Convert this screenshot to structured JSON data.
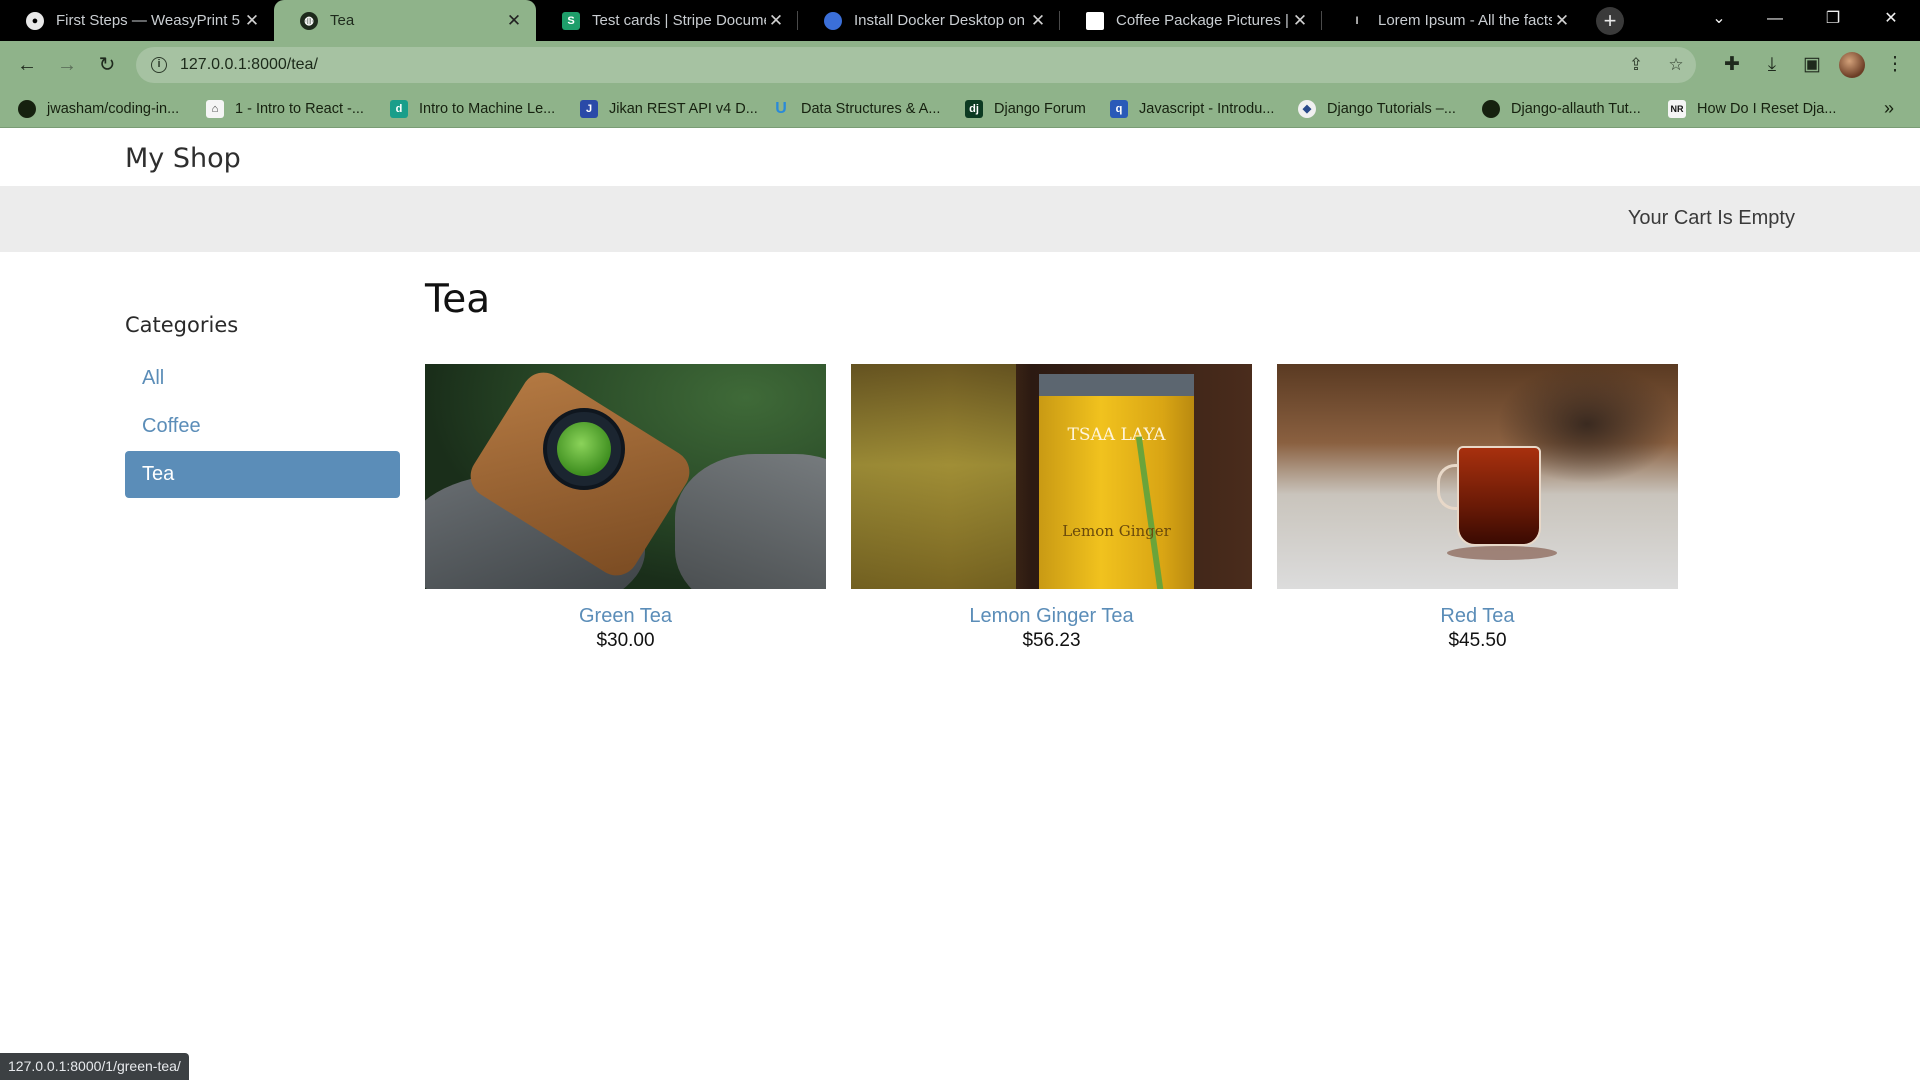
{
  "browser": {
    "tabs": [
      {
        "label": "First Steps — WeasyPrint 5",
        "icon": "github-icon",
        "color": "#ffffff"
      },
      {
        "label": "Tea",
        "icon": "globe-icon",
        "color": "#1e2a1c"
      },
      {
        "label": "Test cards | Stripe Documen",
        "icon": "stripe-icon",
        "color": "#1e9e6a"
      },
      {
        "label": "Install Docker Desktop on V",
        "icon": "firefox-icon",
        "color": "#3b6fd8"
      },
      {
        "label": "Coffee Package Pictures | D",
        "icon": "unsplash-icon",
        "color": "#ffffff"
      },
      {
        "label": "Lorem Ipsum - All the facts",
        "icon": "lipsum-icon",
        "color": "#c8c8c8"
      }
    ],
    "url": "127.0.0.1:8000/tea/",
    "bookmarks": [
      {
        "label": "jwasham/coding-in...",
        "icon": "github-icon"
      },
      {
        "label": "1 - Intro to React -...",
        "icon": "building-icon"
      },
      {
        "label": "Intro to Machine Le...",
        "icon": "d-icon"
      },
      {
        "label": "Jikan REST API v4 D...",
        "icon": "j-icon"
      },
      {
        "label": "Data Structures & A...",
        "icon": "u-icon"
      },
      {
        "label": "Django Forum",
        "icon": "dj-icon"
      },
      {
        "label": "Javascript - Introdu...",
        "icon": "q-icon"
      },
      {
        "label": "Django Tutorials –...",
        "icon": "python-icon"
      },
      {
        "label": "Django-allauth Tut...",
        "icon": "globe-icon"
      },
      {
        "label": "How Do I Reset Dja...",
        "icon": "nr-icon"
      }
    ],
    "status_url": "127.0.0.1:8000/1/green-tea/"
  },
  "shop": {
    "brand": "My Shop",
    "cart": "Your Cart Is Empty",
    "categories_title": "Categories",
    "categories": [
      {
        "label": "All",
        "selected": false
      },
      {
        "label": "Coffee",
        "selected": false
      },
      {
        "label": "Tea",
        "selected": true
      }
    ],
    "heading": "Tea",
    "products": [
      {
        "name": "Green Tea",
        "price": "$30.00"
      },
      {
        "name": "Lemon Ginger Tea",
        "price": "$56.23"
      },
      {
        "name": "Red Tea",
        "price": "$45.50"
      }
    ],
    "lemon_tin_brand": "TSAA LAYA",
    "lemon_tin_label": "Lemon Ginger"
  },
  "colors": {
    "accent": "#5b8db8",
    "chrome": "#8fb38a"
  }
}
